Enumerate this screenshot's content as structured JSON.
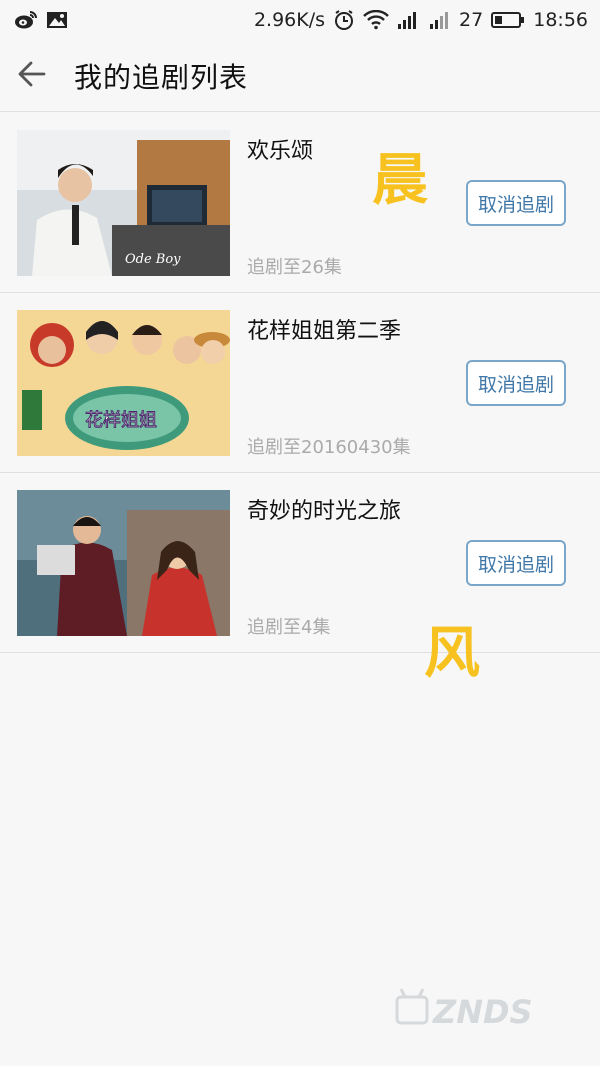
{
  "status_bar": {
    "speed": "2.96K/s",
    "battery": "27",
    "time": "18:56",
    "icons": [
      "weibo-icon",
      "image-icon",
      "alarm-icon",
      "wifi-icon",
      "signal-icon",
      "signal-icon-2",
      "battery-icon"
    ]
  },
  "header": {
    "title": "我的追剧列表",
    "back_icon": "arrow-left-icon"
  },
  "shows": [
    {
      "title": "欢乐颂",
      "progress": "追剧至26集",
      "cancel_label": "取消追剧"
    },
    {
      "title": "花样姐姐第二季",
      "progress": "追剧至20160430集",
      "cancel_label": "取消追剧"
    },
    {
      "title": "奇妙的时光之旅",
      "progress": "追剧至4集",
      "cancel_label": "取消追剧"
    }
  ],
  "watermark": {
    "char1": "晨",
    "char2": "风",
    "logo": "ZNDS"
  },
  "colors": {
    "accent": "#3f78a8",
    "watermark": "#f7c21f"
  }
}
